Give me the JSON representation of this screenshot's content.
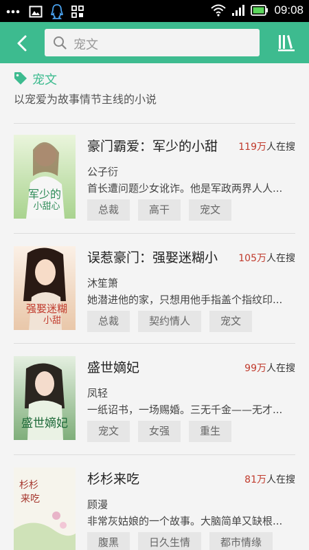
{
  "status_bar": {
    "time": "09:08",
    "icons": [
      "more-icon",
      "image-icon",
      "qq-icon",
      "apps-icon",
      "wifi-icon",
      "signal-icon",
      "battery-icon"
    ]
  },
  "header": {
    "search_text": "宠文",
    "accent_color": "#3dbb8f"
  },
  "category": {
    "title": "宠文",
    "description": "以宠爱为故事情节主线的小说"
  },
  "books": [
    {
      "title": "豪门霸爱：军少的小甜",
      "count": "119万",
      "count_suffix": "人在搜",
      "author": "公子衍",
      "desc": "首长遭问题少女讹诈。他是军政两界人人...",
      "tags": [
        "总裁",
        "高干",
        "宠文"
      ],
      "cover_text": "军少的小甜心",
      "cover_bg": [
        "#dff0c8",
        "#b8dca0"
      ]
    },
    {
      "title": "误惹豪门：强娶迷糊小",
      "count": "105万",
      "count_suffix": "人在搜",
      "author": "沐笙箫",
      "desc": "她潜进他的家，只想用他手指盖个指纹印...",
      "tags": [
        "总裁",
        "契约情人",
        "宠文"
      ],
      "cover_text": "强娶迷糊小甜",
      "cover_bg": [
        "#f6e6d8",
        "#e8c4a4"
      ]
    },
    {
      "title": "盛世嫡妃",
      "count": "99万",
      "count_suffix": "人在搜",
      "author": "凤轻",
      "desc": "一纸诏书，一场赐婚。三无千金——无才...",
      "tags": [
        "宠文",
        "女强",
        "重生"
      ],
      "cover_text": "盛世嫡妃",
      "cover_bg": [
        "#d9e8d0",
        "#8cb88a"
      ]
    },
    {
      "title": "杉杉来吃",
      "count": "81万",
      "count_suffix": "人在搜",
      "author": "顾漫",
      "desc": "非常灰姑娘的一个故事。大脑简单又缺根...",
      "tags": [
        "腹黑",
        "日久生情",
        "都市情缘"
      ],
      "cover_text": "杉杉来吃",
      "cover_bg": [
        "#f4f2ea",
        "#d8e4c4"
      ]
    }
  ]
}
